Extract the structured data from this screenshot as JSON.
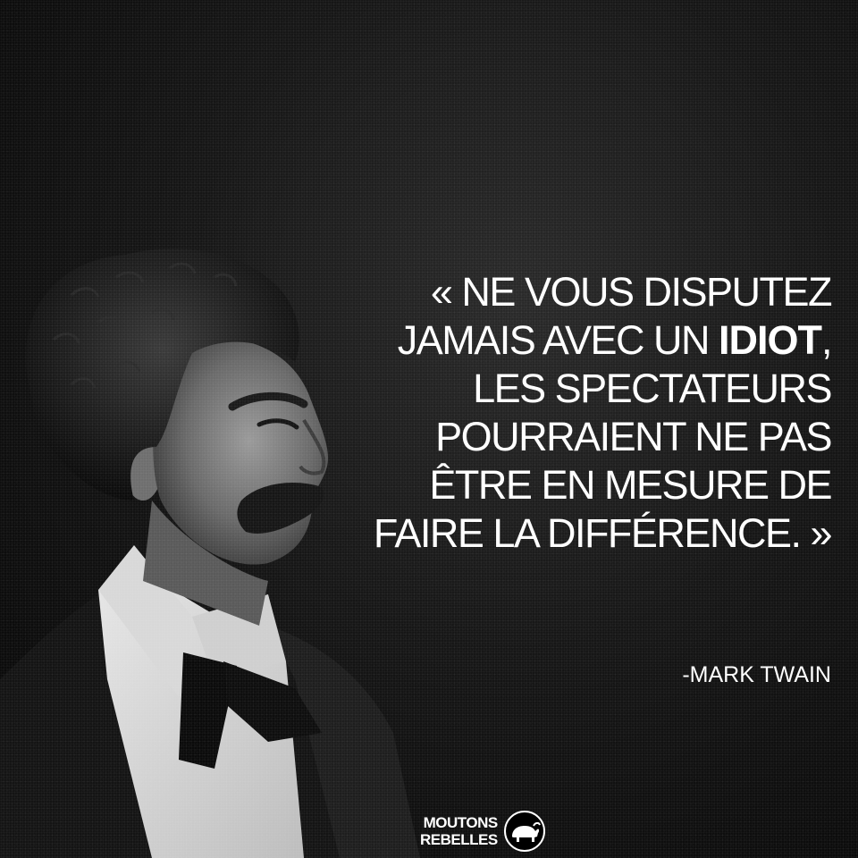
{
  "quote": {
    "line1": "« NE VOUS DISPUTEZ",
    "line2_pre": "JAMAIS AVEC UN ",
    "line2_bold": "IDIOT",
    "line2_post": ",",
    "line3": "LES SPECTATEURS",
    "line4": "POURRAIENT NE PAS",
    "line5": "ÊTRE EN MESURE DE",
    "line6": "FAIRE LA DIFFÉRENCE. »"
  },
  "author": "-MARK TWAIN",
  "logo": {
    "line1": "MOUTONS",
    "line2": "REBELLES",
    "emblem": "sheep-icon"
  },
  "portrait": {
    "subject": "portrait-photo"
  },
  "colors": {
    "background": "#0d0d0d",
    "text": "#ffffff"
  }
}
